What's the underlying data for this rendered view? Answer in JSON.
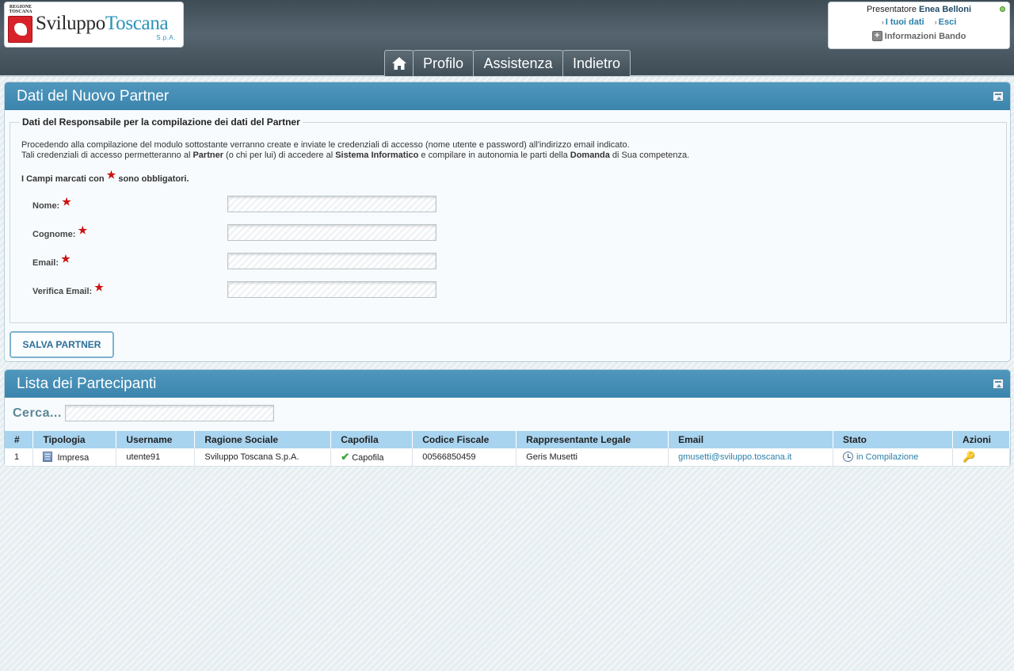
{
  "header": {
    "logo": {
      "region_text": "REGIONE TOSCANA",
      "brand_part1": "Sviluppo",
      "brand_part2": "Toscana",
      "spa": "S.p.A."
    },
    "user": {
      "role_label": "Presentatore",
      "name": "Enea Belloni",
      "link_my_data": "I tuoi dati",
      "link_exit": "Esci",
      "info_bando": "Informazioni Bando"
    },
    "nav": {
      "home_icon": "home-icon",
      "profilo": "Profilo",
      "assistenza": "Assistenza",
      "indietro": "Indietro"
    }
  },
  "panel_partner": {
    "title": "Dati del Nuovo Partner",
    "fieldset_legend": "Dati del Responsabile per la compilazione dei dati del Partner",
    "intro": {
      "line1": "Procedendo alla compilazione del modulo sottostante verranno create e inviate le credenziali di accesso (nome utente e password) all'indirizzo email indicato.",
      "line2_a": "Tali credenziali di accesso permetteranno al ",
      "line2_partner": "Partner",
      "line2_b": " (o chi per lui) di accedere al ",
      "line2_sistema": "Sistema Informatico",
      "line2_c": " e compilare in autonomia le parti della ",
      "line2_domanda": "Domanda",
      "line2_d": " di Sua competenza."
    },
    "required_note_a": "I Campi marcati con",
    "required_star": "★",
    "required_note_b": "sono obbligatori.",
    "fields": {
      "nome_label": "Nome:",
      "nome_value": "",
      "cognome_label": "Cognome:",
      "cognome_value": "",
      "email_label": "Email:",
      "email_value": "",
      "verifica_label": "Verifica Email:",
      "verifica_value": ""
    },
    "save_button": "SALVA PARTNER"
  },
  "panel_partecipanti": {
    "title": "Lista dei Partecipanti",
    "search_label": "Cerca...",
    "search_value": "",
    "columns": [
      "#",
      "Tipologia",
      "Username",
      "Ragione Sociale",
      "Capofila",
      "Codice Fiscale",
      "Rappresentante Legale",
      "Email",
      "Stato",
      "Azioni"
    ],
    "rows": [
      {
        "num": "1",
        "tipologia": "Impresa",
        "username": "utente91",
        "ragione_sociale": "Sviluppo Toscana S.p.A.",
        "capofila": "Capofila",
        "codice_fiscale": "00566850459",
        "rappresentante": "Geris Musetti",
        "email": "gmusetti@sviluppo.toscana.it",
        "stato": "in Compilazione",
        "azioni_icon": "key-icon"
      }
    ]
  },
  "colors": {
    "header_bg": "#455560",
    "panel_title_bg": "#4590b8",
    "table_header_bg": "#a8d4f0",
    "link": "#2a7fa8",
    "required_star": "#cc1111"
  }
}
